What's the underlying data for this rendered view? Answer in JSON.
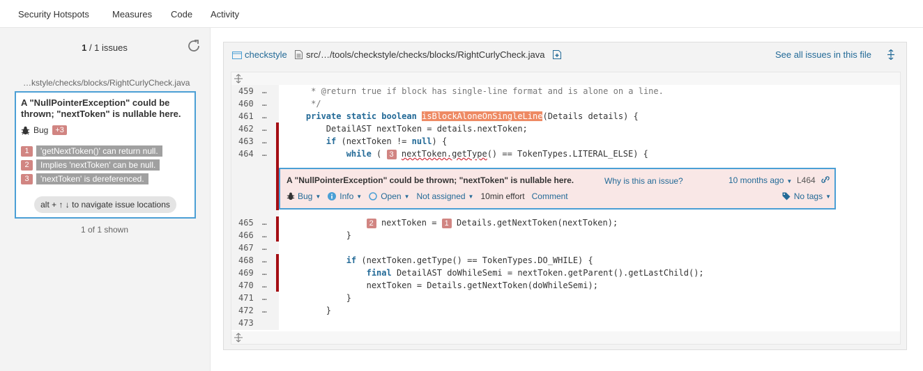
{
  "nav": {
    "items": [
      "Security Hotspots",
      "Measures",
      "Code",
      "Activity"
    ]
  },
  "sidebar": {
    "count_current": "1",
    "count_total": "/ 1",
    "count_label": "issues",
    "file_path": "…kstyle/checks/blocks/RightCurlyCheck.java",
    "issue": {
      "title": "A \"NullPointerException\" could be thrown; \"nextToken\" is nullable here.",
      "type": "Bug",
      "extra_badge": "+3",
      "flows": [
        {
          "num": "1",
          "msg": "'getNextToken()' can return null."
        },
        {
          "num": "2",
          "msg": "Implies 'nextToken' can be null."
        },
        {
          "num": "3",
          "msg": "'nextToken' is dereferenced."
        }
      ],
      "nav_hint": "alt + ↑ ↓ to navigate issue locations"
    },
    "shown": "1 of 1 shown"
  },
  "header": {
    "project": "checkstyle",
    "file": "src/…/tools/checkstyle/checks/blocks/RightCurlyCheck.java",
    "see_all": "See all issues in this file"
  },
  "code_lines": [
    {
      "ln": "459",
      "dots": "…",
      "bar": false
    },
    {
      "ln": "460",
      "dots": "…",
      "bar": false
    },
    {
      "ln": "461",
      "dots": "…",
      "bar": false
    },
    {
      "ln": "462",
      "dots": "…",
      "bar": true
    },
    {
      "ln": "463",
      "dots": "…",
      "bar": true
    },
    {
      "ln": "464",
      "dots": "…",
      "bar": true
    },
    {
      "ln": "465",
      "dots": "…",
      "bar": true
    },
    {
      "ln": "466",
      "dots": "…",
      "bar": true
    },
    {
      "ln": "467",
      "dots": "…",
      "bar": false
    },
    {
      "ln": "468",
      "dots": "…",
      "bar": true
    },
    {
      "ln": "469",
      "dots": "…",
      "bar": true
    },
    {
      "ln": "470",
      "dots": "…",
      "bar": true
    },
    {
      "ln": "471",
      "dots": "…",
      "bar": false
    },
    {
      "ln": "472",
      "dots": "…",
      "bar": false
    },
    {
      "ln": "473",
      "dots": "",
      "bar": false
    }
  ],
  "code": {
    "l459": "     * @return true if block has single-line format and is alone on a line.",
    "l460": "     */",
    "l461_kw": "private static boolean",
    "l461_fn": "isBlockAloneOnSingleLine",
    "l461_rest": "(Details details) {",
    "l462": "        DetailAST nextToken = details.nextToken;",
    "l463_kw": "if",
    "l463_a": " (nextToken != ",
    "l463_null": "null",
    "l463_b": ") {",
    "l464_kw": "while",
    "l464_a": " ( ",
    "l464_loc": "3",
    "l464_wavy": "nextToken.getType",
    "l464_b": "() == TokenTypes.LITERAL_ELSE) {",
    "l465_loc2": "2",
    "l465_a": "nextToken = ",
    "l465_loc1": "1",
    "l465_b": "Details.getNextToken(nextToken);",
    "l466": "}",
    "l468_kw": "if",
    "l468_a": " (nextToken.getType() == TokenTypes.DO_WHILE) {",
    "l469_kw": "final",
    "l469_a": " DetailAST doWhileSemi = nextToken.getParent().getLastChild();",
    "l470": "nextToken = Details.getNextToken(doWhileSemi);",
    "l471": "}",
    "l472": "}"
  },
  "inline_issue": {
    "title": "A \"NullPointerException\" could be thrown; \"nextToken\" is nullable here.",
    "why": "Why is this an issue?",
    "date": "10 months ago",
    "line": "L464",
    "type": "Bug",
    "severity": "Info",
    "status": "Open",
    "assignee": "Not assigned",
    "effort": "10min effort",
    "comment": "Comment",
    "tags": "No tags"
  }
}
